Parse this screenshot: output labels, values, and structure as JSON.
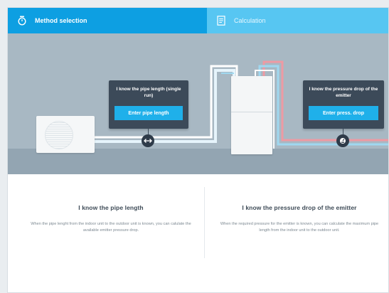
{
  "tabs": {
    "method_selection": "Method selection",
    "calculation": "Calculation"
  },
  "cards": {
    "pipe_length": {
      "text": "I know the pipe length (single run)",
      "button": "Enter pipe length"
    },
    "pressure_drop": {
      "text": "I know the pressure drop of the emitter",
      "button": "Enter press. drop"
    }
  },
  "options": {
    "pipe_length": {
      "title": "I know the pipe length",
      "description": "When the pipe lenght from the indoor unit to the outdoor unit is known, you can calulate the available emitter pressure drop."
    },
    "pressure_drop": {
      "title": "I know the pressure drop of the emitter",
      "description": "When the required pressure for the emitter is known, you can calculate the maximum pipe length from the indoor unit to the outdoor unit."
    }
  },
  "icons": {
    "method_selection_tab": "stopwatch-icon",
    "calculation_tab": "document-icon",
    "pipe_marker": "double-arrow-icon",
    "pressure_marker": "gauge-icon"
  },
  "colors": {
    "tab_active": "#0d9fe2",
    "tab_inactive": "#57c6f2",
    "card_bg": "#3c4a59",
    "button": "#1fb0ea",
    "supply_pipe": "#ee9aa3",
    "return_pipe": "#9fd8f0"
  }
}
